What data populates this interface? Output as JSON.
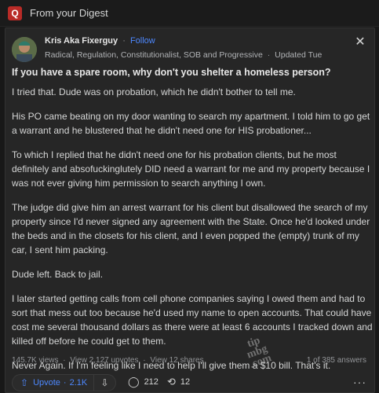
{
  "top_bar": {
    "logo_letter": "Q",
    "label": "From your Digest"
  },
  "post": {
    "author": {
      "name": "Kris Aka Fixerguy",
      "follow_label": "Follow",
      "credentials": "Radical, Regulation, Constitutionalist, SOB and Progressive",
      "updated": "Updated Tue"
    },
    "question": "If you have a spare room, why don't you shelter a homeless person?",
    "paragraphs": [
      "I tried that. Dude was on probation, which he didn't bother to tell me.",
      "His PO came beating on my door wanting to search my apartment. I told him to go get a warrant and he blustered that he didn't need one for HIS probationer...",
      "To which I replied that he didn't need one for his probation clients, but he most definitely and absofuckinglutely DID need a warrant for me and my property because I was not ever giving him permission to search anything I own.",
      "The judge did give him an arrest warrant for his client but disallowed the search of my property since I'd never signed any agreement with the State. Once he'd looked under the beds and in the closets for his client, and I even popped the (empty) trunk of my car, I sent him packing.",
      "Dude left. Back to jail.",
      "I later started getting calls from cell phone companies saying I owed them and had to sort that mess out too because he'd used my name to open accounts. That could have cost me several thousand dollars as there were at least 6 accounts I tracked down and killed off before he could get to them.",
      "Never Again. If I'm feeling like I need to help I'll give them a $10 bill. That's it."
    ],
    "stats": {
      "views": "145.7K views",
      "upvotes": "View 2,127 upvotes",
      "shares": "View 12 shares",
      "answers": "1 of 385 answers"
    },
    "actions": {
      "upvote_label": "Upvote",
      "upvote_count": "2.1K",
      "comments": "212",
      "shares": "12"
    }
  },
  "watermark": {
    "line1": "tip",
    "line2": "mbg",
    "line3": ".com"
  },
  "colors": {
    "accent": "#4d88ff",
    "brand": "#b92b27",
    "card_bg": "#262626",
    "page_bg": "#181818"
  },
  "icons": [
    "quora-logo",
    "avatar",
    "close-icon",
    "upvote-arrow-icon",
    "downvote-arrow-icon",
    "comment-icon",
    "share-icon",
    "more-icon"
  ]
}
